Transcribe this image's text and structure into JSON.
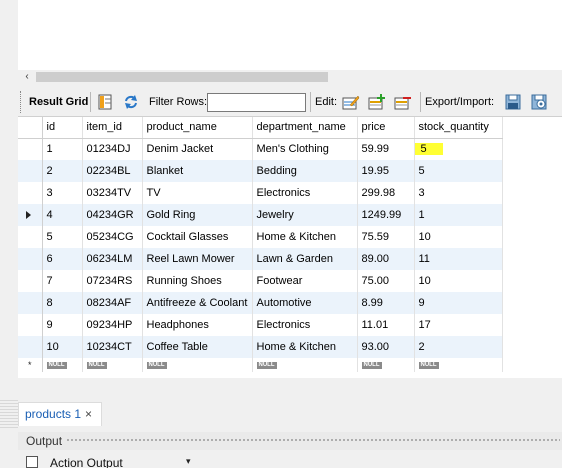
{
  "scrollbar": {
    "left_arrow": "‹"
  },
  "toolbar": {
    "result_grid_label": "Result Grid",
    "filter_rows_label": "Filter Rows:",
    "filter_rows_value": "",
    "edit_label": "Edit:",
    "export_import_label": "Export/Import:"
  },
  "grid": {
    "columns": [
      "id",
      "item_id",
      "product_name",
      "department_name",
      "price",
      "stock_quantity"
    ],
    "rows": [
      [
        "1",
        "01234DJ",
        "Denim Jacket",
        "Men's Clothing",
        "59.99",
        "5"
      ],
      [
        "2",
        "02234BL",
        "Blanket",
        "Bedding",
        "19.95",
        "5"
      ],
      [
        "3",
        "03234TV",
        "TV",
        "Electronics",
        "299.98",
        "3"
      ],
      [
        "4",
        "04234GR",
        "Gold Ring",
        "Jewelry",
        "1249.99",
        "1"
      ],
      [
        "5",
        "05234CG",
        "Cocktail Glasses",
        "Home & Kitchen",
        "75.59",
        "10"
      ],
      [
        "6",
        "06234LM",
        "Reel Lawn Mower",
        "Lawn & Garden",
        "89.00",
        "11"
      ],
      [
        "7",
        "07234RS",
        "Running Shoes",
        "Footwear",
        "75.00",
        "10"
      ],
      [
        "8",
        "08234AF",
        "Antifreeze & Coolant",
        "Automotive",
        "8.99",
        "9"
      ],
      [
        "9",
        "09234HP",
        "Headphones",
        "Electronics",
        "11.01",
        "17"
      ],
      [
        "10",
        "10234CT",
        "Coffee Table",
        "Home & Kitchen",
        "93.00",
        "2"
      ]
    ],
    "null_text": "NULL",
    "new_row_marker": "*",
    "highlight_color": "#ffff33"
  },
  "bottom": {
    "tab_label": "products 1",
    "tab_close": "×",
    "output_label": "Output",
    "action_output_label": "Action Output",
    "action_caret": "▾"
  }
}
